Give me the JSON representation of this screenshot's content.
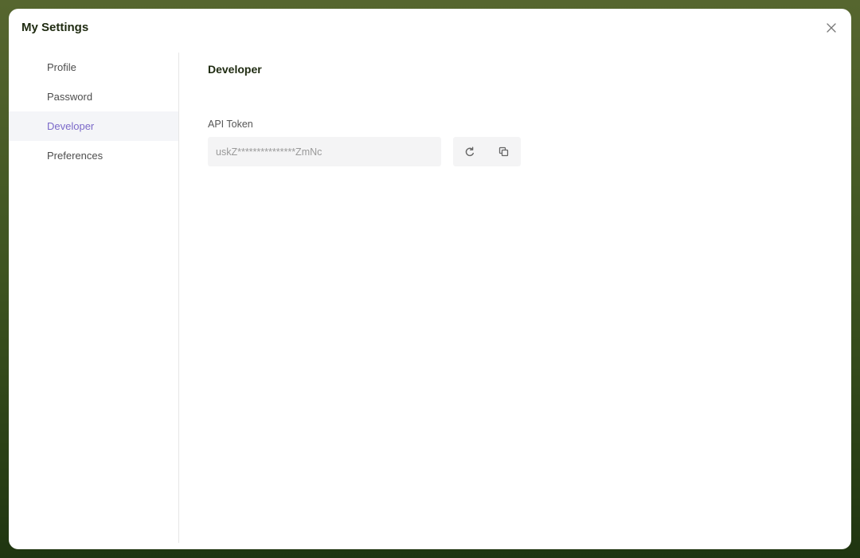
{
  "modal": {
    "title": "My Settings"
  },
  "sidebar": {
    "items": [
      {
        "label": "Profile",
        "active": false
      },
      {
        "label": "Password",
        "active": false
      },
      {
        "label": "Developer",
        "active": true
      },
      {
        "label": "Preferences",
        "active": false
      }
    ]
  },
  "developer": {
    "section_title": "Developer",
    "api_token_label": "API Token",
    "api_token_value": "uskZ***************ZmNc",
    "regenerate_icon": "refresh-icon",
    "copy_icon": "copy-icon"
  },
  "colors": {
    "accent": "#7b69c9",
    "background": "#3d5320"
  }
}
